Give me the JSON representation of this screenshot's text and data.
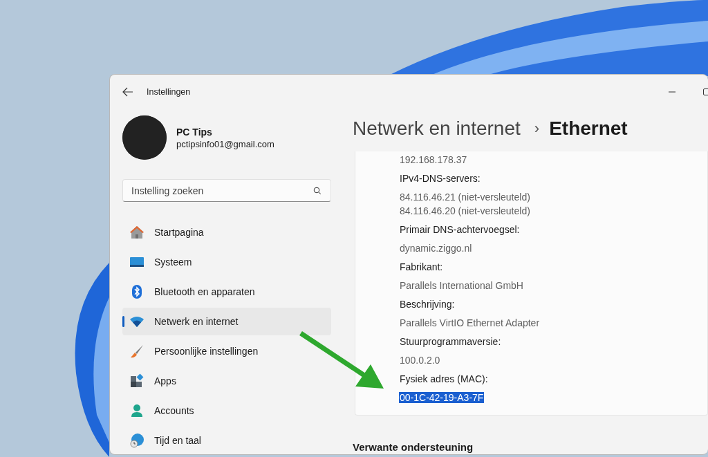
{
  "window": {
    "title": "Instellingen"
  },
  "profile": {
    "name": "PC Tips",
    "email": "pctipsinfo01@gmail.com"
  },
  "search": {
    "placeholder": "Instelling zoeken"
  },
  "nav": [
    {
      "label": "Startpagina",
      "selected": false
    },
    {
      "label": "Systeem",
      "selected": false
    },
    {
      "label": "Bluetooth en apparaten",
      "selected": false
    },
    {
      "label": "Netwerk en internet",
      "selected": true
    },
    {
      "label": "Persoonlijke instellingen",
      "selected": false
    },
    {
      "label": "Apps",
      "selected": false
    },
    {
      "label": "Accounts",
      "selected": false
    },
    {
      "label": "Tijd en taal",
      "selected": false
    }
  ],
  "breadcrumb": {
    "parent": "Netwerk en internet",
    "separator": "›",
    "current": "Ethernet"
  },
  "details": [
    {
      "kind": "value",
      "text": "192.168.178.37",
      "selected": false
    },
    {
      "kind": "label",
      "text": "IPv4-DNS-servers:",
      "selected": false
    },
    {
      "kind": "value",
      "text": "84.116.46.21 (niet-versleuteld)",
      "selected": false
    },
    {
      "kind": "value",
      "text": "84.116.46.20 (niet-versleuteld)",
      "selected": false
    },
    {
      "kind": "label",
      "text": "Primair DNS-achtervoegsel:",
      "selected": false
    },
    {
      "kind": "value",
      "text": "dynamic.ziggo.nl",
      "selected": false
    },
    {
      "kind": "label",
      "text": "Fabrikant:",
      "selected": false
    },
    {
      "kind": "value",
      "text": "Parallels International GmbH",
      "selected": false
    },
    {
      "kind": "label",
      "text": "Beschrijving:",
      "selected": false
    },
    {
      "kind": "value",
      "text": "Parallels VirtIO Ethernet Adapter",
      "selected": false
    },
    {
      "kind": "label",
      "text": "Stuurprogrammaversie:",
      "selected": false
    },
    {
      "kind": "value",
      "text": "100.0.2.0",
      "selected": false
    },
    {
      "kind": "label",
      "text": "Fysiek adres (MAC):",
      "selected": false
    },
    {
      "kind": "value",
      "text": "00-1C-42-19-A3-7F",
      "selected": true
    }
  ],
  "section_heading": "Verwante ondersteuning"
}
